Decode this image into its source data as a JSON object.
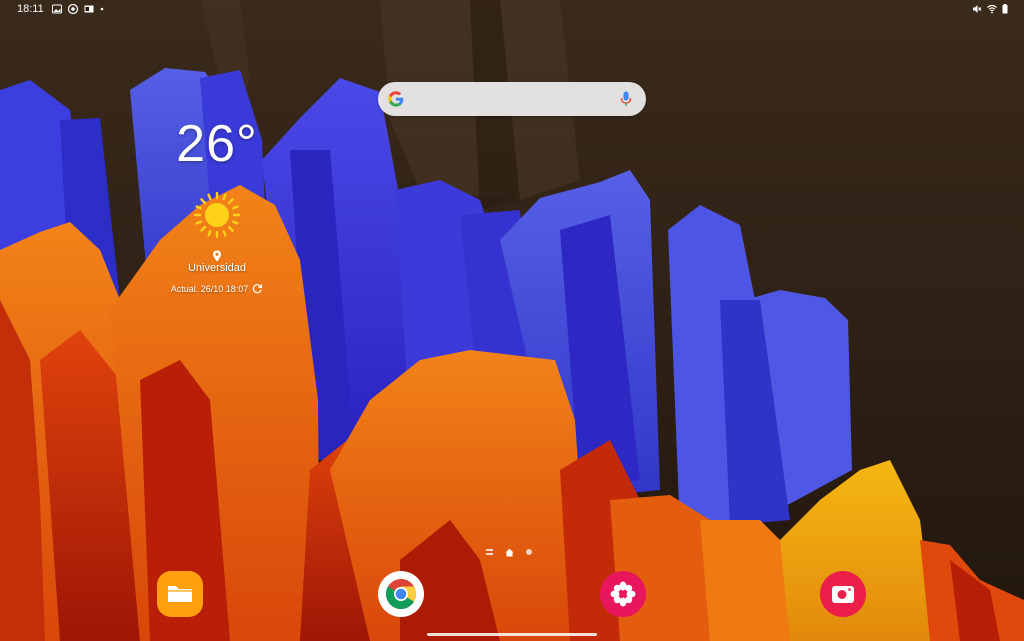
{
  "status_bar": {
    "time": "18:11",
    "left_icons": [
      "gallery-notification-icon",
      "chrome-notification-icon",
      "outlook-notification-icon",
      "more-notifications-dot-icon"
    ],
    "right_icons": [
      "mute-icon",
      "wifi-icon",
      "battery-icon"
    ]
  },
  "search_widget": {
    "logo": "google-g-icon",
    "mic": "microphone-icon"
  },
  "weather_widget": {
    "temperature": "26°",
    "condition_icon": "sunny-icon",
    "location": "Universidad",
    "updated": "Actual. 26/10 18:07",
    "refresh_icon": "refresh-icon"
  },
  "home_pages": {
    "indicators": [
      "menu-lines-icon",
      "home-icon",
      "page-dot-icon"
    ],
    "current": 2
  },
  "dock": {
    "apps": [
      {
        "name": "files-app-icon",
        "color": "#ffa10f"
      },
      {
        "name": "chrome-app-icon",
        "color": "#ffffff"
      },
      {
        "name": "gallery-app-icon",
        "color": "#e8175d"
      },
      {
        "name": "camera-app-icon",
        "color": "#ec1f4a"
      }
    ]
  },
  "colors": {
    "wallpaper_background": "#2a1c11",
    "wallpaper_blue": "#3a35d8",
    "wallpaper_orange": "#f06a0e",
    "wallpaper_red": "#c2200a",
    "wallpaper_yellow": "#f2b10f"
  }
}
